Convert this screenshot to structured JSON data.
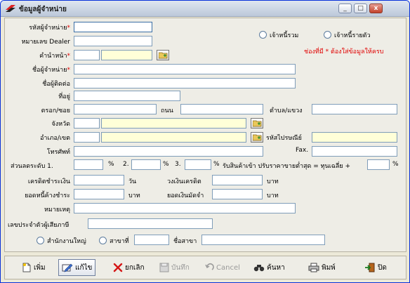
{
  "window": {
    "title": "ข้อมูลผู้จำหน่าย",
    "minimize": "_",
    "maximize": "□",
    "close": "x"
  },
  "form": {
    "vendor_code_label": "รหัสผู้จำหน่าย",
    "dealer_no_label": "หมายเลข Dealer",
    "prefix_label": "คำนำหน้า",
    "vendor_name_label": "ชื่อผู้จำหน่าย",
    "contact_label": "ชื่อผู้ติดต่อ",
    "address_label": "ที่อยู่",
    "soi_label": "ตรอก/ซอย",
    "road_label": "ถนน",
    "subdistrict_label": "ตำบล/แขวง",
    "province_label": "จังหวัด",
    "district_label": "อำเภอ/เขต",
    "postcode_label": "รหัสไปรษณีย์",
    "phone_label": "โทรศัพท์",
    "fax_label": "Fax.",
    "discount_label": "ส่วนลดระดับ 1.",
    "discount_pct": "%",
    "discount_2_label": "2.",
    "discount_3_label": "3.",
    "discount_note": "รับสินค้าเข้า ปรับราคาขายต่ำสุด = ทุนเฉลี่ย +",
    "credit_term_label": "เครดิตชำระเงิน",
    "day_unit": "วัน",
    "credit_limit_label": "วงเงินเครดิต",
    "baht_unit": "บาท",
    "outstanding_label": "ยอดหนี้ค้างชำระ",
    "deposit_label": "ยอดเงินมัดจำ",
    "remark_label": "หมายเหตุ",
    "tax_id_label": "เลขประจำตัวผู้เสียภาษี",
    "head_office_label": "สำนักงานใหญ่",
    "branch_label": "สาขาที่",
    "branch_name_label": "ชื่อสาขา",
    "creditor_combined": "เจ้าหนี้รวม",
    "creditor_individual": "เจ้าหนี้รายตัว",
    "required_notice": "ช่องที่มี * ต้องใส่ข้อมูลให้ครบ",
    "required_mark": "*"
  },
  "toolbar": {
    "add": "เพิ่ม",
    "edit": "แก้ไข",
    "cancel_item": "ยกเลิก",
    "save": "บันทึก",
    "cancel": "Cancel",
    "search": "ค้นหา",
    "print": "พิมพ์",
    "close": "ปิด"
  }
}
